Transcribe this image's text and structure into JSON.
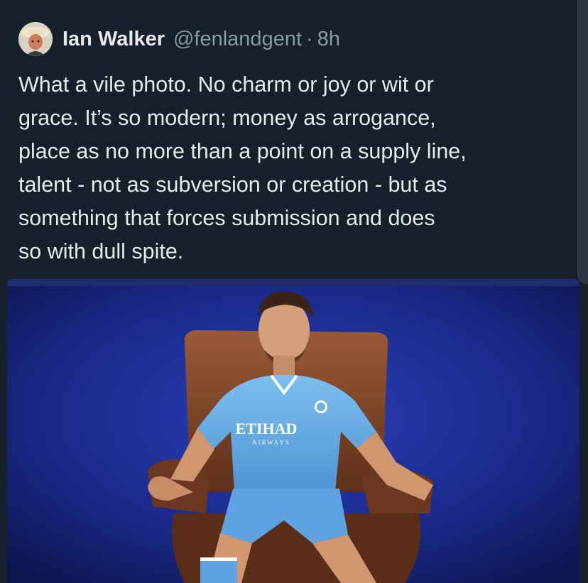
{
  "tweet": {
    "author": {
      "display_name": "Ian Walker",
      "handle": "@fenlandgent",
      "separator": "·",
      "time": "8h",
      "avatar_icon": "user-avatar"
    },
    "text_lines": [
      "What a vile photo. No charm or joy or wit or",
      "grace. It’s so modern; money as arrogance,",
      "place as no more than a point on a supply line,",
      "talent - not as subversion or creation - but as",
      "something that forces submission and does",
      "so with dull spite."
    ],
    "media": {
      "kit_sponsor_line1": "ETIHAD",
      "kit_sponsor_line2": "AIRWAYS"
    }
  },
  "colors": {
    "background": "#15202b",
    "text_primary": "#e7e9ea",
    "text_secondary": "#8b98a5",
    "photo_backdrop": "#1a2a8a",
    "kit_blue": "#6aaee6",
    "chair_brown": "#7a4326"
  }
}
